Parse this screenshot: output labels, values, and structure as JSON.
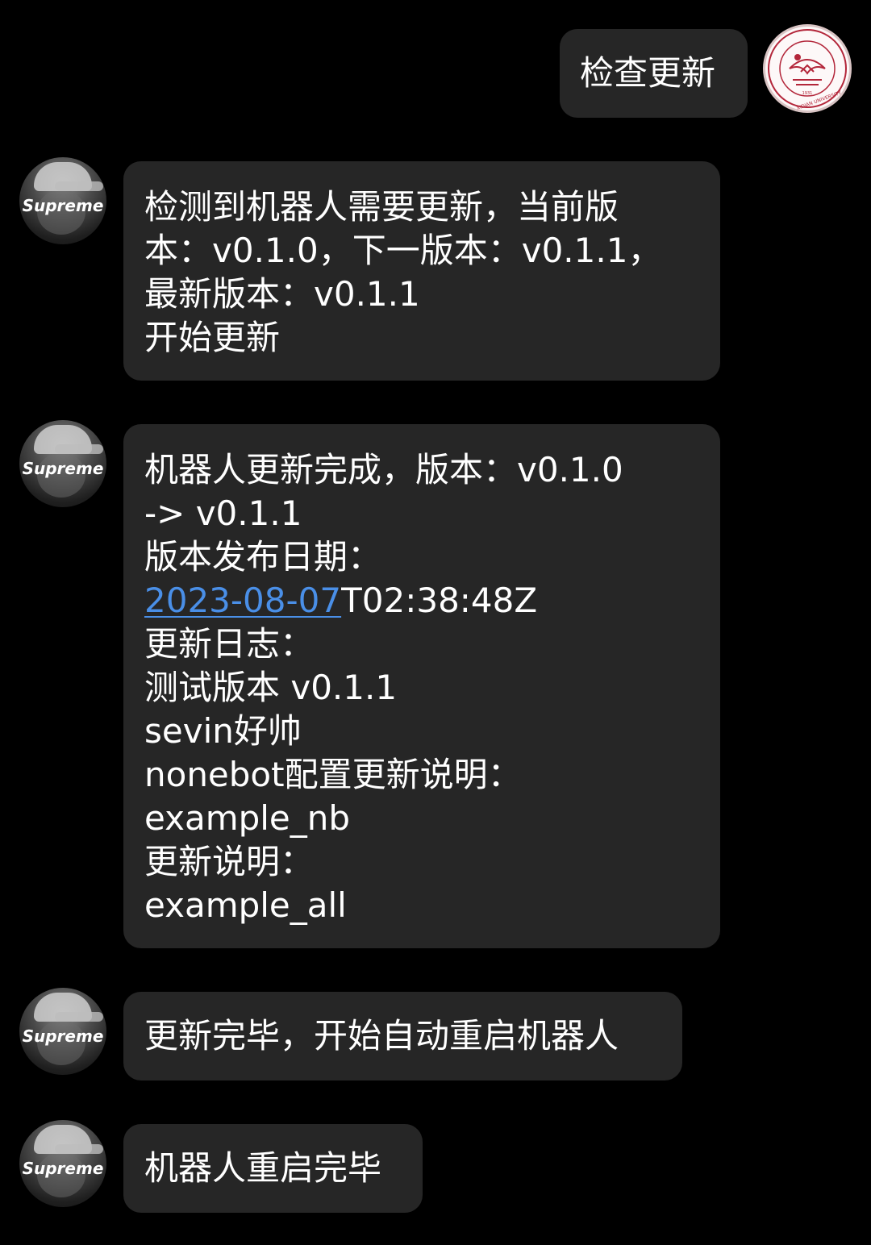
{
  "user_message": {
    "text": "检查更新",
    "avatar": {
      "icon": "university-seal-icon",
      "seal_text": "XIDIAN UNIVERSITY",
      "year": "1931",
      "color": "#b3263a"
    }
  },
  "bot": {
    "avatar": {
      "label": "Supreme"
    }
  },
  "messages": {
    "m1": {
      "lines": [
        "检测到机器人需要更新，当前版",
        "本：v0.1.0，下一版本：v0.1.1，",
        "最新版本：v0.1.1",
        "开始更新"
      ]
    },
    "m2": {
      "line1": "机器人更新完成，版本：v0.1.0",
      "line2": "-> v0.1.1",
      "line3": "版本发布日期：",
      "date_link": "2023-08-07",
      "time_suffix": "T02:38:48Z",
      "line5": "更新日志：",
      "line6": "测试版本 v0.1.1",
      "line7": "sevin好帅",
      "line8": "nonebot配置更新说明：",
      "line9": "example_nb",
      "line10": "更新说明：",
      "line11": "example_all"
    },
    "m3": {
      "text": "更新完毕，开始自动重启机器人"
    },
    "m4": {
      "text": "机器人重启完毕"
    }
  },
  "colors": {
    "background": "#000000",
    "bubble": "#262626",
    "text": "#ffffff",
    "link": "#4a8fe7"
  }
}
